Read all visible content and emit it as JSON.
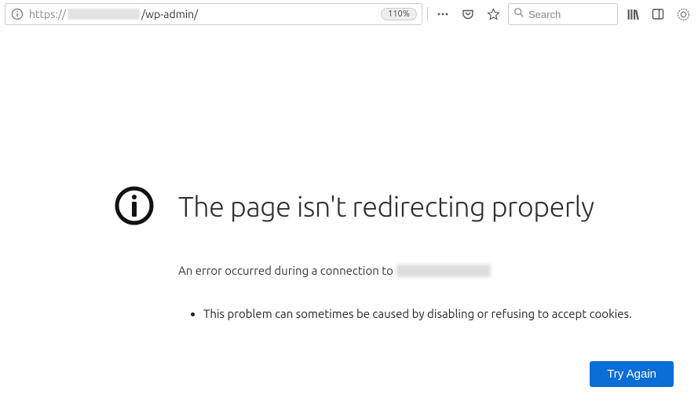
{
  "toolbar": {
    "url_prefix": "https://",
    "url_path": "/wp-admin/",
    "zoom": "110%",
    "search_placeholder": "Search"
  },
  "error": {
    "title": "The page isn't redirecting properly",
    "subtitle": "An error occurred during a connection to",
    "bullet": "This problem can sometimes be caused by disabling or refusing to accept cookies.",
    "button": "Try Again"
  }
}
